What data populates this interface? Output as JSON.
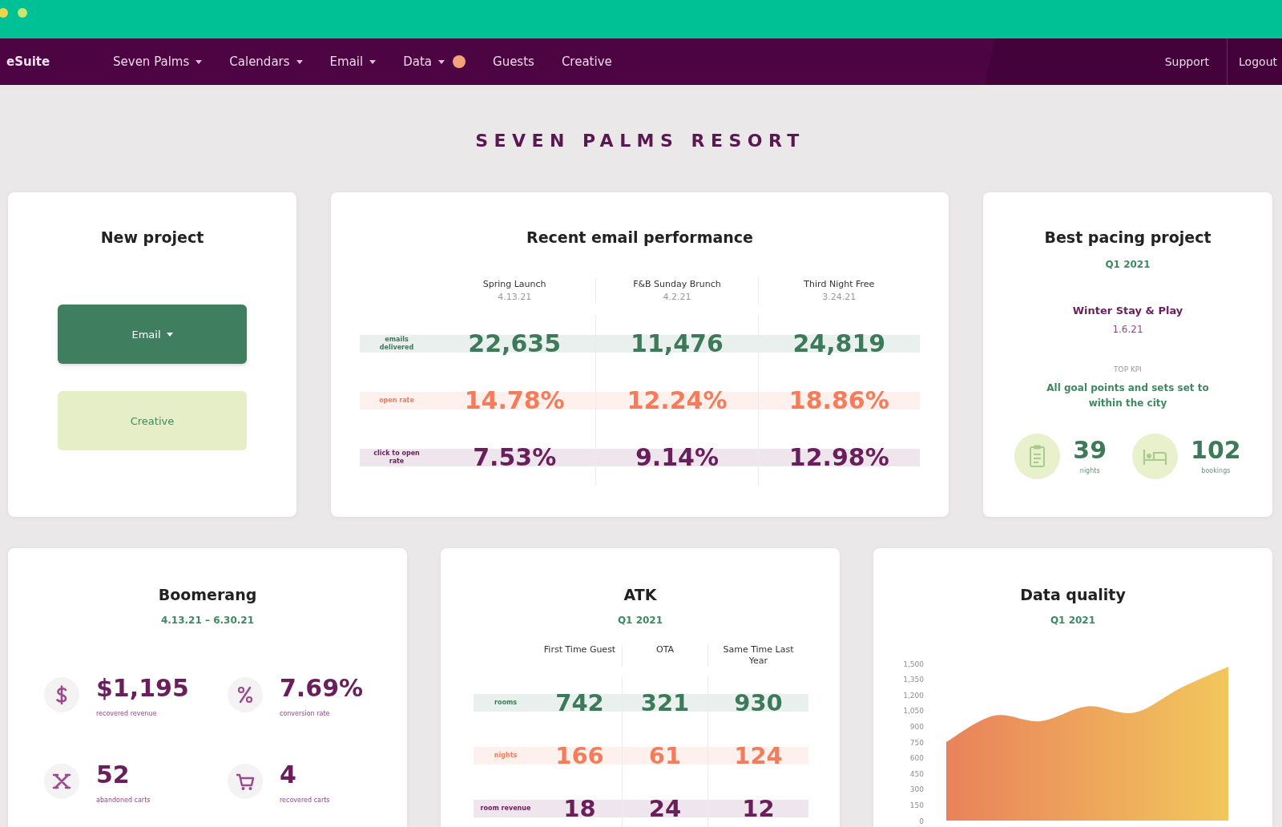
{
  "nav": {
    "logo": "eSuite",
    "items": [
      {
        "label": "Seven Palms",
        "dropdown": true,
        "badge": false
      },
      {
        "label": "Calendars",
        "dropdown": true,
        "badge": false
      },
      {
        "label": "Email",
        "dropdown": true,
        "badge": false
      },
      {
        "label": "Data",
        "dropdown": true,
        "badge": true
      },
      {
        "label": "Guests",
        "dropdown": false,
        "badge": false
      },
      {
        "label": "Creative",
        "dropdown": false,
        "badge": false
      }
    ],
    "right_items": [
      "Support",
      "Logout"
    ]
  },
  "page_title": "SEVEN PALMS RESORT",
  "new_project": {
    "title": "New project",
    "buttons": [
      {
        "label": "Email",
        "kind": "primary",
        "dropdown": true
      },
      {
        "label": "Creative",
        "kind": "secondary",
        "dropdown": false
      }
    ]
  },
  "email_performance": {
    "title": "Recent email performance",
    "columns": [
      {
        "name": "Spring Launch",
        "date": "4.13.21"
      },
      {
        "name": "F&B Sunday Brunch",
        "date": "4.2.21"
      },
      {
        "name": "Third Night Free",
        "date": "3.24.21"
      }
    ],
    "rows": [
      {
        "label": "emails delivered",
        "color": "#3d7a5a",
        "values": [
          "22,635",
          "11,476",
          "24,819"
        ]
      },
      {
        "label": "open rate",
        "color": "#f47c5b",
        "values": [
          "14.78%",
          "12.24%",
          "18.86%"
        ]
      },
      {
        "label": "click to open rate",
        "color": "#6a1f5c",
        "values": [
          "7.53%",
          "9.14%",
          "12.98%"
        ]
      }
    ]
  },
  "best_pacing": {
    "title": "Best pacing project",
    "period": "Q1 2021",
    "project": "Winter Stay & Play",
    "date": "1.6.21",
    "kpi_label": "TOP KPI",
    "kpi_text": "All goal points and sets set to within the city",
    "stats": [
      {
        "kind": "clipboard",
        "value": "39",
        "label": "nights"
      },
      {
        "kind": "bed",
        "value": "102",
        "label": "bookings"
      }
    ]
  },
  "boomerang": {
    "title": "Boomerang",
    "period": "4.13.21 – 6.30.21",
    "stats": [
      {
        "kind": "dollar",
        "value": "$1,195",
        "label": "recovered revenue"
      },
      {
        "kind": "percent",
        "value": "7.69%",
        "label": "conversion rate"
      },
      {
        "kind": "cross",
        "value": "52",
        "label": "abandoned carts"
      },
      {
        "kind": "cart",
        "value": "4",
        "label": "recovered carts"
      }
    ]
  },
  "atk": {
    "title": "ATK",
    "period": "Q1 2021",
    "columns": [
      "First Time Guest",
      "OTA",
      "Same Time Last Year"
    ],
    "rows": [
      {
        "label": "rooms",
        "color": "#3d7a5a",
        "values": [
          "742",
          "321",
          "930"
        ]
      },
      {
        "label": "nights",
        "color": "#f47c5b",
        "values": [
          "166",
          "61",
          "124"
        ]
      },
      {
        "label": "room revenue",
        "color": "#6a1f5c",
        "values": [
          "18",
          "24",
          "12"
        ]
      }
    ]
  },
  "data_quality": {
    "title": "Data quality",
    "period": "Q1 2021",
    "y_axis_labels": [
      "1,500",
      "1,350",
      "1,200",
      "1,050",
      "900",
      "750",
      "600",
      "450",
      "300",
      "150",
      "0"
    ]
  }
}
